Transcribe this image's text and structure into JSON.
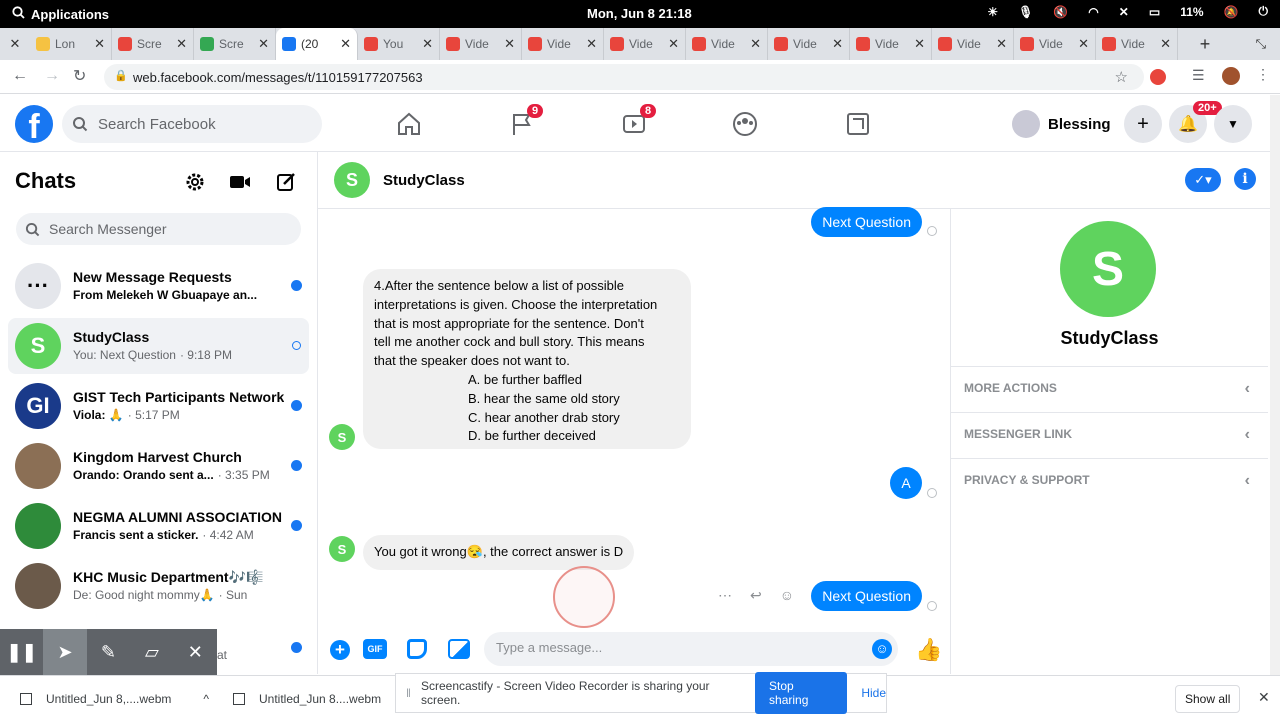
{
  "system_bar": {
    "apps_label": "Applications",
    "clock": "Mon, Jun 8   21:18",
    "battery": "11%"
  },
  "tabs": [
    {
      "label": "Lon",
      "color": "#f5c242"
    },
    {
      "label": "Scre",
      "color": "#e8453c"
    },
    {
      "label": "Scre",
      "color": "#34a853"
    },
    {
      "label": "(20",
      "color": "#1877f2",
      "active": true
    },
    {
      "label": "You",
      "color": "#e8453c"
    },
    {
      "label": "Vide",
      "color": "#e8453c"
    },
    {
      "label": "Vide",
      "color": "#e8453c"
    },
    {
      "label": "Vide",
      "color": "#e8453c"
    },
    {
      "label": "Vide",
      "color": "#e8453c"
    },
    {
      "label": "Vide",
      "color": "#e8453c"
    },
    {
      "label": "Vide",
      "color": "#e8453c"
    },
    {
      "label": "Vide",
      "color": "#e8453c"
    },
    {
      "label": "Vide",
      "color": "#e8453c"
    },
    {
      "label": "Vide",
      "color": "#e8453c"
    }
  ],
  "address": {
    "url": "web.facebook.com/messages/t/110159177207563"
  },
  "fb_header": {
    "search_placeholder": "Search Facebook",
    "pages_badge": "9",
    "watch_badge": "8",
    "profile_name": "Blessing",
    "notifications_badge": "20+"
  },
  "sidebar": {
    "title": "Chats",
    "search_placeholder": "Search Messenger",
    "chats": [
      {
        "name": "New Message Requests",
        "preview_sender": "From Melekeh W Gbuapaye an...",
        "preview": "",
        "time": "",
        "avatar_text": "···",
        "avatar_color": "#e4e6eb",
        "unread": true
      },
      {
        "name": "StudyClass",
        "preview_sender": "",
        "preview": "You: Next Question",
        "time": "· 9:18 PM",
        "avatar_text": "S",
        "avatar_color": "#5fd35e",
        "unread": false,
        "selected": true
      },
      {
        "name": "GIST Tech Participants Network",
        "preview_sender": "Viola: 🙏",
        "preview": "",
        "time": "· 5:17 PM",
        "avatar_text": "GI",
        "avatar_color": "#1a3a8a",
        "unread": true
      },
      {
        "name": "Kingdom Harvest Church",
        "preview_sender": "Orando: Orando sent a...",
        "preview": "",
        "time": "· 3:35 PM",
        "avatar_text": "",
        "avatar_color": "#8b6f55",
        "unread": true
      },
      {
        "name": "NEGMA ALUMNI ASSOCIATION",
        "preview_sender": "Francis sent a sticker.",
        "preview": "",
        "time": "· 4:42 AM",
        "avatar_text": "",
        "avatar_color": "#2e8b3a",
        "unread": true
      },
      {
        "name": "KHC Music Department🎶🎼",
        "preview_sender": "",
        "preview": "De: Good night mommy🙏",
        "time": "· Sun",
        "avatar_text": "",
        "avatar_color": "#6b5a4a",
        "unread": false
      }
    ],
    "partial_preview": "at"
  },
  "conversation": {
    "name": "StudyClass",
    "avatar_letter": "S",
    "msg_top_me": "Next Question",
    "question_lines": [
      "4.After the sentence below a list of possible",
      "interpretations is given. Choose the interpretation",
      "that is most appropriate for the sentence. Don't",
      "tell me another cock and bull story. This means",
      "that the speaker does not want to."
    ],
    "options": [
      "A. be further baffled",
      "B. hear the same old story",
      "C. hear another drab story",
      "D. be further deceived"
    ],
    "my_answer": "A",
    "feedback": "You got it wrong😪, the correct answer is D",
    "msg_bottom_me": "Next Question",
    "composer_placeholder": "Type a message..."
  },
  "info_panel": {
    "name": "StudyClass",
    "avatar_letter": "S",
    "sections": [
      "MORE ACTIONS",
      "MESSENGER LINK",
      "PRIVACY & SUPPORT"
    ]
  },
  "downloads": {
    "items": [
      "Untitled_Jun 8,....webm",
      "Untitled_Jun 8....webm"
    ],
    "show_all": "Show all"
  },
  "share_notice": {
    "text": "Screencastify - Screen Video Recorder is sharing your screen.",
    "stop": "Stop sharing",
    "hide": "Hide"
  },
  "colors": {
    "fb_blue": "#1877f2",
    "messenger_blue": "#0084ff",
    "avatar_green": "#5fd35e",
    "badge_red": "#e41e3f"
  }
}
